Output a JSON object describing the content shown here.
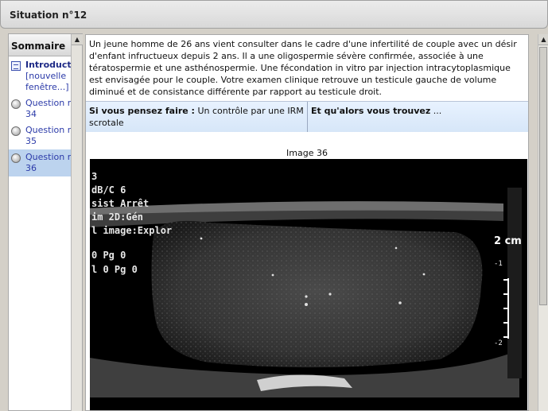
{
  "header": {
    "title": "Situation n°12"
  },
  "sidebar": {
    "title": "Sommaire",
    "items": [
      {
        "line1": "Introduction",
        "line2": "[nouvelle",
        "line3": "fenêtre...]"
      },
      {
        "line1": "Question n",
        "line2": "34"
      },
      {
        "line1": "Question n",
        "line2": "35"
      },
      {
        "line1": "Question n",
        "line2": "36"
      }
    ]
  },
  "main": {
    "intro": "Un jeune homme de 26 ans vient consulter dans le cadre d'une infertilité de couple avec un désir d'enfant infructueux depuis 2 ans. Il a une oligospermie sévère confirmée, associée à une tératospermie et une asthénospermie. Une fécondation in vitro par injection intracytoplasmique est envisagée pour le couple. Votre examen clinique retrouve un testicule gauche de volume diminué et de consistance différente par rapport au testicule droit.",
    "if_label": "Si vous pensez faire :",
    "if_value": "Un contrôle par une IRM scrotale",
    "then_label": "Et qu'alors vous trouvez",
    "then_value": "...",
    "image_caption": "Image 36"
  },
  "ultrasound": {
    "overlay_lines": [
      "3",
      "dB/C 6",
      "sist Arrêt",
      "im 2D:Gén",
      "l image:Explor"
    ],
    "row1": "0   Pg 0",
    "row2": "l 0   Pg 0",
    "scale_label": "2 cm",
    "scale_ticks": [
      "-1",
      "-2"
    ]
  }
}
